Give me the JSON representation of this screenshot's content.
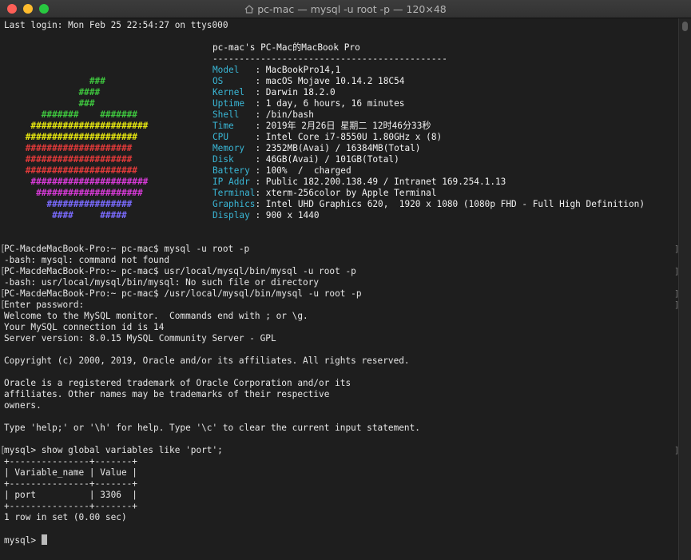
{
  "window": {
    "title": "pc-mac — mysql -u root -p — 120×48"
  },
  "login_line": "Last login: Mon Feb 25 22:54:27 on ttys000",
  "neofetch": {
    "header": "pc-mac's PC-Mac的MacBook Pro",
    "rule": "--------------------------------------------",
    "logo": [
      {
        "text": "                ###",
        "color": "green"
      },
      {
        "text": "              ####",
        "color": "green"
      },
      {
        "text": "              ###",
        "color": "green"
      },
      {
        "text": "       #######    #######",
        "color": "green"
      },
      {
        "text": "     ######################",
        "color": "yellow"
      },
      {
        "text": "    #####################",
        "color": "yellow"
      },
      {
        "text": "    ####################",
        "color": "red"
      },
      {
        "text": "    ####################",
        "color": "red"
      },
      {
        "text": "    #####################",
        "color": "red"
      },
      {
        "text": "     ######################",
        "color": "mag"
      },
      {
        "text": "      ####################",
        "color": "mag"
      },
      {
        "text": "        ################",
        "color": "purple"
      },
      {
        "text": "         ####     #####",
        "color": "purple"
      }
    ],
    "info": [
      {
        "key": "Model   ",
        "value": "MacBookPro14,1"
      },
      {
        "key": "OS      ",
        "value": "macOS Mojave 10.14.2 18C54"
      },
      {
        "key": "Kernel  ",
        "value": "Darwin 18.2.0"
      },
      {
        "key": "Uptime  ",
        "value": "1 day, 6 hours, 16 minutes"
      },
      {
        "key": "Shell   ",
        "value": "/bin/bash"
      },
      {
        "key": "Time    ",
        "value": "2019年 2月26日 星期二 12时46分33秒"
      },
      {
        "key": "CPU     ",
        "value": "Intel Core i7-8550U 1.80GHz x (8)"
      },
      {
        "key": "Memory  ",
        "value": "2352MB(Avai) / 16384MB(Total)"
      },
      {
        "key": "Disk    ",
        "value": "46GB(Avai) / 101GB(Total)"
      },
      {
        "key": "Battery ",
        "value": "100%  /  charged"
      },
      {
        "key": "IP Addr ",
        "value": "Public 182.200.138.49 / Intranet 169.254.1.13"
      },
      {
        "key": "Terminal",
        "value": "xterm-256color by Apple Terminal"
      },
      {
        "key": "Graphics",
        "value": "Intel UHD Graphics 620,  1920 x 1080 (1080p FHD - Full High Definition)"
      },
      {
        "key": "Display ",
        "value": "900 x 1440"
      }
    ]
  },
  "session": [
    {
      "text": "PC-MacdeMacBook-Pro:~ pc-mac$ mysql -u root -p",
      "prompt": true
    },
    {
      "text": "-bash: mysql: command not found",
      "prompt": false
    },
    {
      "text": "PC-MacdeMacBook-Pro:~ pc-mac$ usr/local/mysql/bin/mysql -u root -p",
      "prompt": true
    },
    {
      "text": "-bash: usr/local/mysql/bin/mysql: No such file or directory",
      "prompt": false
    },
    {
      "text": "PC-MacdeMacBook-Pro:~ pc-mac$ /usr/local/mysql/bin/mysql -u root -p",
      "prompt": true
    },
    {
      "text": "Enter password: ",
      "prompt": true
    },
    {
      "text": "Welcome to the MySQL monitor.  Commands end with ; or \\g.",
      "prompt": false
    },
    {
      "text": "Your MySQL connection id is 14",
      "prompt": false
    },
    {
      "text": "Server version: 8.0.15 MySQL Community Server - GPL",
      "prompt": false
    },
    {
      "text": "",
      "prompt": false
    },
    {
      "text": "Copyright (c) 2000, 2019, Oracle and/or its affiliates. All rights reserved.",
      "prompt": false
    },
    {
      "text": "",
      "prompt": false
    },
    {
      "text": "Oracle is a registered trademark of Oracle Corporation and/or its",
      "prompt": false
    },
    {
      "text": "affiliates. Other names may be trademarks of their respective",
      "prompt": false
    },
    {
      "text": "owners.",
      "prompt": false
    },
    {
      "text": "",
      "prompt": false
    },
    {
      "text": "Type 'help;' or '\\h' for help. Type '\\c' to clear the current input statement.",
      "prompt": false
    },
    {
      "text": "",
      "prompt": false
    },
    {
      "text": "mysql> show global variables like 'port';",
      "prompt": true
    },
    {
      "text": "+---------------+-------+",
      "prompt": false
    },
    {
      "text": "| Variable_name | Value |",
      "prompt": false
    },
    {
      "text": "+---------------+-------+",
      "prompt": false
    },
    {
      "text": "| port          | 3306  |",
      "prompt": false
    },
    {
      "text": "+---------------+-------+",
      "prompt": false
    },
    {
      "text": "1 row in set (0.00 sec)",
      "prompt": false
    },
    {
      "text": "",
      "prompt": false
    }
  ],
  "current_prompt": "mysql> ",
  "colors": {
    "green": "#3ec43e",
    "yellow": "#e5e510",
    "red": "#e03a3a",
    "mag": "#d63ad6",
    "purple": "#7a6bff",
    "key": "#3ab7d6"
  }
}
